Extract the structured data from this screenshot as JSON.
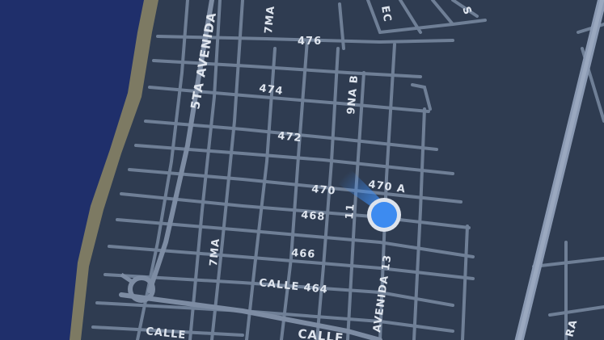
{
  "map": {
    "colors": {
      "land": "#2f3c51",
      "water": "#1f2f6b",
      "shore": "#7d7a63",
      "street": "#6f7f96",
      "highway": "#8b9ab3",
      "location": "#3d8bf0"
    },
    "street_labels": {
      "avenida_5ta": "5TA AVENIDA",
      "seventh_ma": "7MA",
      "seventh_ma_south": "7MA",
      "calle_476": "476",
      "calle_474": "474",
      "calle_472": "472",
      "calle_470": "470",
      "calle_470a": "470 A",
      "calle_468": "468",
      "calle_466": "466",
      "calle_464": "CALLE 464",
      "ninth_na_b": "9NA B",
      "eleven_partial": "11",
      "avenida_13": "AVENIDA 13",
      "calle_bottom_left": "CALLE",
      "calle_bottom_center": "CALLE",
      "ec_partial": "EC",
      "top_right_partial": "S",
      "ra_partial": "RA"
    },
    "icons": {
      "location_dot": "current-location-icon",
      "heading_cone": "heading-cone-icon",
      "roundabout": "roundabout-icon"
    }
  }
}
